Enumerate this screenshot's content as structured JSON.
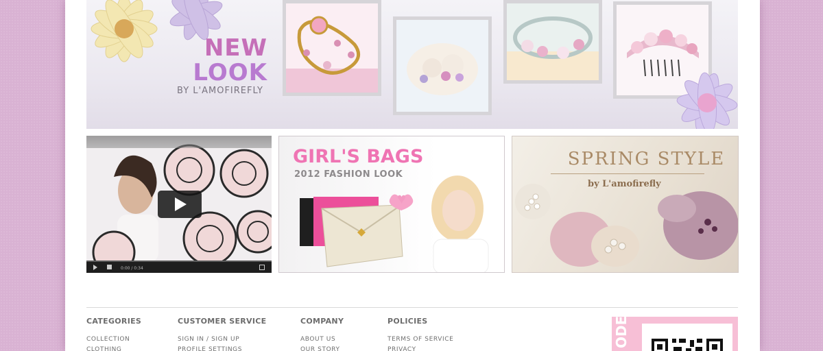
{
  "hero": {
    "title_line1": "NEW",
    "title_line2": "LOOK",
    "byline": "BY  L'AMOFIREFLY"
  },
  "promos": {
    "video": {
      "time": "0:00 / 0:34"
    },
    "bags": {
      "title": "GIRL'S BAGS",
      "subtitle": "2012 FASHION LOOK"
    },
    "spring": {
      "title": "SPRING  STYLE",
      "byline": "by L'amofirefly"
    }
  },
  "footer": {
    "columns": [
      {
        "heading": "CATEGORIES",
        "links": [
          "COLLECTION",
          "CLOTHING"
        ]
      },
      {
        "heading": "CUSTOMER SERVICE",
        "links": [
          "SIGN IN / SIGN UP",
          "PROFILE SETTINGS"
        ]
      },
      {
        "heading": "COMPANY",
        "links": [
          "ABOUT US",
          "OUR STORY"
        ]
      },
      {
        "heading": "POLICIES",
        "links": [
          "TERMS OF SERVICE",
          "PRIVACY"
        ]
      }
    ],
    "qr_label": "ODE"
  },
  "colors": {
    "background": "#d9b2d3",
    "accent_pink": "#ef74b3",
    "title_magenta": "#c56fb8",
    "qr_pink": "#f7bfd6"
  }
}
